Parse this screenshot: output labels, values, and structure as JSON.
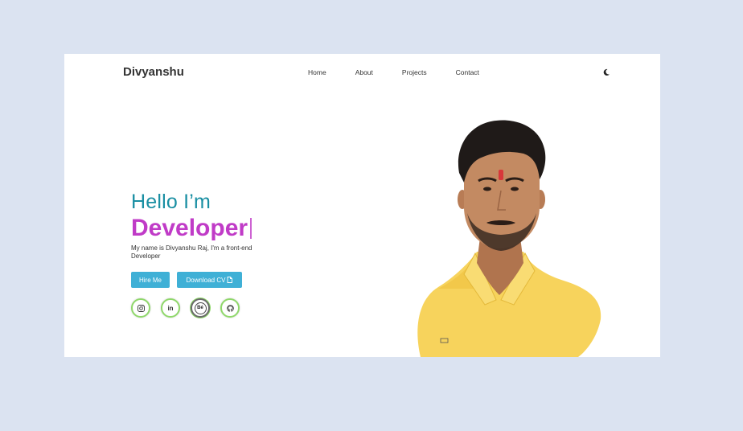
{
  "header": {
    "logo": "Divyanshu",
    "nav": [
      "Home",
      "About",
      "Projects",
      "Contact"
    ],
    "theme_toggle_icon": "moon-icon"
  },
  "hero": {
    "greeting": "Hello I’m",
    "role": "Developer",
    "intro": "My name is Divyanshu Raj, I'm a front-end Developer",
    "hire_label": "Hire Me",
    "cv_label": "Download CV",
    "cv_icon": "file-icon",
    "socials": [
      {
        "icon": "instagram-icon"
      },
      {
        "icon": "linkedin-icon",
        "text": "in"
      },
      {
        "icon": "behance-icon",
        "text": "Bé"
      },
      {
        "icon": "github-icon"
      }
    ],
    "portrait_icon": "profile-photo"
  },
  "colors": {
    "page_bg": "#dbe3f1",
    "greeting": "#1a8fa3",
    "role": "#c03bc7",
    "button": "#3fb0d6",
    "social_ring": "#8fd86a",
    "shirt": "#f7d35c"
  }
}
